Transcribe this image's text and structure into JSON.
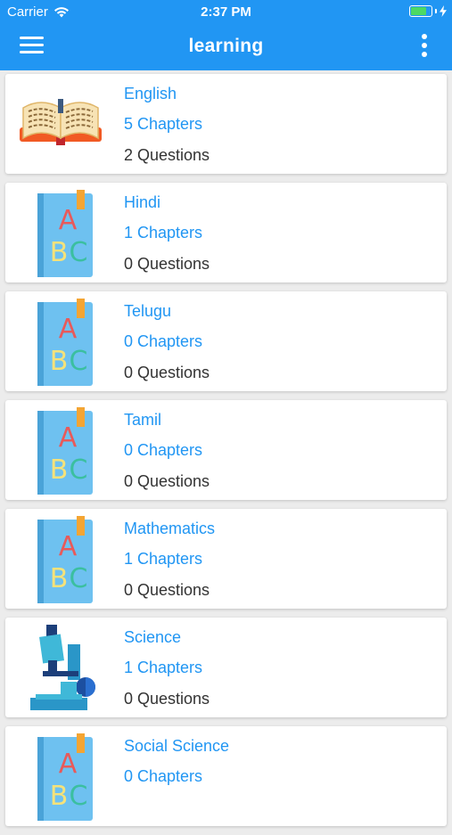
{
  "status_bar": {
    "carrier": "Carrier",
    "time": "2:37 PM",
    "battery_level": 0.85,
    "battery_color": "#4cd964"
  },
  "app_bar": {
    "title": "learning",
    "menu_icon": "hamburger-menu-icon",
    "more_icon": "more-vertical-icon",
    "color": "#2196f3"
  },
  "subjects": [
    {
      "name": "English",
      "chapters": "5 Chapters",
      "questions": "2 Questions",
      "icon": "open-book-icon"
    },
    {
      "name": "Hindi",
      "chapters": "1 Chapters",
      "questions": "0 Questions",
      "icon": "abc-book-icon"
    },
    {
      "name": "Telugu",
      "chapters": "0 Chapters",
      "questions": "0 Questions",
      "icon": "abc-book-icon"
    },
    {
      "name": "Tamil",
      "chapters": "0 Chapters",
      "questions": "0 Questions",
      "icon": "abc-book-icon"
    },
    {
      "name": "Mathematics",
      "chapters": "1 Chapters",
      "questions": "0 Questions",
      "icon": "abc-book-icon"
    },
    {
      "name": "Science",
      "chapters": "1 Chapters",
      "questions": "0 Questions",
      "icon": "microscope-icon"
    },
    {
      "name": "Social Science",
      "chapters": "0 Chapters",
      "questions": "",
      "icon": "abc-book-icon"
    }
  ]
}
